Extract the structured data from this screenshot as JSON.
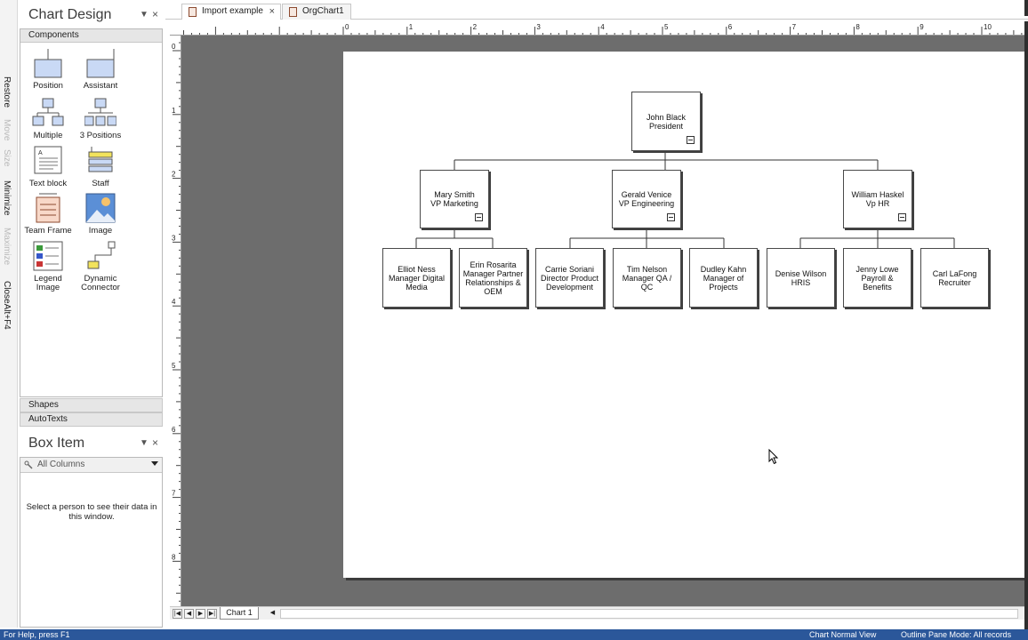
{
  "side_strip": {
    "items": [
      "Restore",
      "Move",
      "Size",
      "Minimize",
      "Maximize",
      "CloseAlt+F4"
    ]
  },
  "chart_design": {
    "title": "Chart Design",
    "pin_icon": "dropdown-arrow-icon",
    "close_icon": "close-icon",
    "section": "Components",
    "components": [
      "Position",
      "Assistant",
      "Multiple",
      "3 Positions",
      "Text block",
      "Staff",
      "Team Frame",
      "Image",
      "Legend Image",
      "Dynamic Connector"
    ],
    "shapes_label": "Shapes",
    "autotexts_label": "AutoTexts"
  },
  "box_item": {
    "title": "Box Item",
    "columns_value": "All Columns",
    "empty_message": "Select a person to see their data in this window."
  },
  "tabs": {
    "import_example": "Import example",
    "orgchart1": "OrgChart1"
  },
  "rulers": {
    "horizontal": [
      "0",
      "1",
      "2",
      "3",
      "4",
      "5",
      "6",
      "7",
      "8",
      "9",
      "10"
    ],
    "vertical": [
      "0",
      "1",
      "2",
      "3",
      "4",
      "5",
      "6",
      "7",
      "8"
    ]
  },
  "org": {
    "president": {
      "name": "John Black",
      "title": "President"
    },
    "vp_marketing": {
      "name": "Mary Smith",
      "title": "VP Marketing"
    },
    "vp_engineering": {
      "name": "Gerald Venice",
      "title": "VP Engineering"
    },
    "vp_hr": {
      "name": "William Haskel",
      "title": "Vp HR"
    },
    "elliot": {
      "name": "Elliot Ness",
      "title": "Manager Digital Media"
    },
    "erin": {
      "name": "Erin Rosarita",
      "title": "Manager Partner Relationships & OEM"
    },
    "carrie": {
      "name": "Carrie Soriani",
      "title": "Director Product Development"
    },
    "tim": {
      "name": "Tim Nelson",
      "title": "Manager QA / QC"
    },
    "dudley": {
      "name": "Dudley Kahn",
      "title": "Manager of Projects"
    },
    "denise": {
      "name": "Denise Wilson",
      "title": "HRIS"
    },
    "jenny": {
      "name": "Jenny Lowe",
      "title": "Payroll & Benefits"
    },
    "carl": {
      "name": "Carl LaFong",
      "title": "Recruiter"
    }
  },
  "sheet": {
    "tab": "Chart 1"
  },
  "status": {
    "help": "For Help, press F1",
    "view": "Chart Normal View",
    "outline": "Outline Pane Mode: All records"
  },
  "colors": {
    "status_bar": "#2b579a",
    "canvas": "#6d6d6d",
    "icon_blue": "#c9d9f5"
  }
}
